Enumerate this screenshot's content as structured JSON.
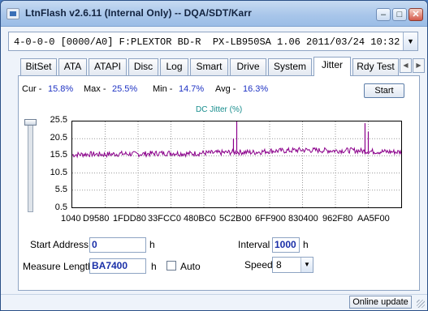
{
  "window": {
    "title": "LtnFlash v2.6.11 (Internal Only) -- DQA/SDT/Karr",
    "minimize_label": "–",
    "maximize_label": "□",
    "close_label": "✕"
  },
  "drive": {
    "value": "4-0-0-0 [0000/A0] F:PLEXTOR BD-R  PX-LB950SA 1.06 2011/03/24 10:32",
    "dropdown_glyph": "▼"
  },
  "tabs": [
    {
      "label": "BitSet"
    },
    {
      "label": "ATA"
    },
    {
      "label": "ATAPI"
    },
    {
      "label": "Disc"
    },
    {
      "label": "Log"
    },
    {
      "label": "Smart"
    },
    {
      "label": "Drive"
    },
    {
      "label": "System"
    },
    {
      "label": "Jitter",
      "active": true
    },
    {
      "label": "Rdy Test"
    }
  ],
  "tab_scroll": {
    "left": "◀",
    "right": "▶"
  },
  "stats": {
    "cur_label": "Cur -",
    "cur_value": "15.8%",
    "max_label": "Max -",
    "max_value": "25.5%",
    "min_label": "Min -",
    "min_value": "14.7%",
    "avg_label": "Avg -",
    "avg_value": "16.3%"
  },
  "start_button": "Start",
  "chart_data": {
    "type": "line",
    "title": "DC Jitter (%)",
    "y_ticks": [
      "25.5",
      "20.5",
      "15.5",
      "10.5",
      "5.5",
      "0.5"
    ],
    "x_ticks": [
      "1040",
      "D9580",
      "1FDD80",
      "33FCC0",
      "480BC0",
      "5C2B00",
      "6FF900",
      "830400",
      "962F80",
      "AA5F00"
    ],
    "ylim": [
      0.5,
      25.5
    ],
    "xlim": [
      0,
      1
    ],
    "grid": true,
    "series": [
      {
        "color": "#8b008b",
        "x": [
          0.0,
          0.05,
          0.1,
          0.15,
          0.2,
          0.25,
          0.3,
          0.35,
          0.4,
          0.45,
          0.5,
          0.55,
          0.6,
          0.65,
          0.7,
          0.75,
          0.8,
          0.85,
          0.9,
          0.95,
          1.0
        ],
        "y": [
          15.8,
          16.0,
          15.9,
          16.1,
          16.0,
          16.2,
          16.3,
          16.1,
          16.3,
          16.4,
          16.6,
          16.5,
          16.9,
          17.0,
          17.2,
          17.1,
          17.0,
          17.1,
          16.8,
          16.7,
          16.6
        ]
      }
    ],
    "spikes": [
      {
        "x": 0.49,
        "y": 20.5
      },
      {
        "x": 0.5,
        "y": 25.5
      },
      {
        "x": 0.89,
        "y": 25.0
      },
      {
        "x": 0.9,
        "y": 22.5
      }
    ]
  },
  "form": {
    "start_address_label": "Start Address",
    "start_address_value": "0",
    "start_address_unit": "h",
    "measure_length_label": "Measure Length",
    "measure_length_value": "BA7400",
    "measure_length_unit": "h",
    "auto_label": "Auto",
    "interval_label": "Interval",
    "interval_value": "1000",
    "interval_unit": "h",
    "speed_label": "Speed",
    "speed_value": "8",
    "speed_arrow": "▼"
  },
  "status": {
    "online_update": "Online update"
  }
}
